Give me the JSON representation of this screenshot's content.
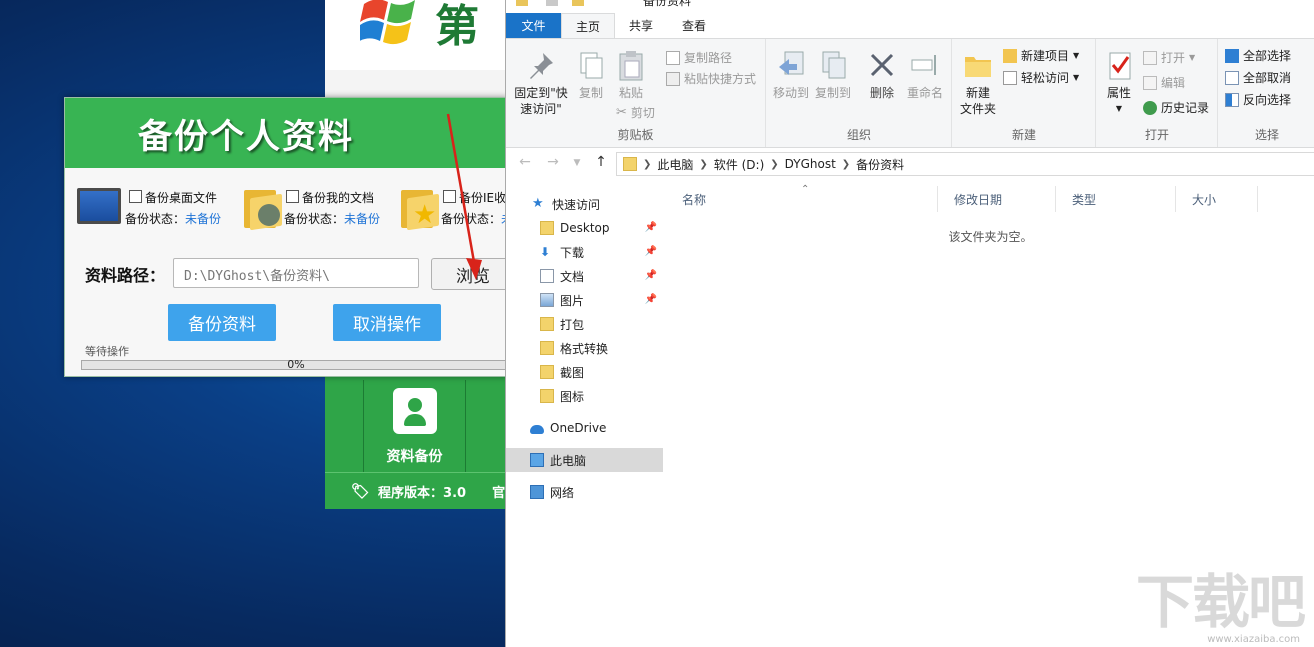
{
  "bg_app": {
    "title_partial": "第一",
    "tile_label": "资料备份",
    "version_text": "程序版本：3.0",
    "footer_tail": "官"
  },
  "dialog": {
    "title": "备份个人资料",
    "options": [
      {
        "label": "备份桌面文件",
        "status_label": "备份状态：",
        "status_value": "未备份"
      },
      {
        "label": "备份我的文档",
        "status_label": "备份状态：",
        "status_value": "未备份"
      },
      {
        "label": "备份IE收",
        "status_label": "备份状态：",
        "status_value": "未"
      }
    ],
    "path_label": "资料路径：",
    "path_value": "D:\\DYGhost\\备份资料\\",
    "browse_label": "浏览",
    "backup_button": "备份资料",
    "cancel_button": "取消操作",
    "wait_text": "等待操作",
    "progress": "0%",
    "progress_value": 0
  },
  "explorer": {
    "window_title": "备份资料",
    "tabs": [
      "文件",
      "主页",
      "共享",
      "查看"
    ],
    "ribbon": {
      "clipboard": {
        "pin_label_1": "固定到\"快",
        "pin_label_2": "速访问\"",
        "copy": "复制",
        "paste": "粘贴",
        "copy_path": "复制路径",
        "paste_shortcut": "粘贴快捷方式",
        "cut": "剪切",
        "title": "剪贴板"
      },
      "organize": {
        "move_to": "移动到",
        "copy_to": "复制到",
        "delete": "删除",
        "rename": "重命名",
        "title": "组织"
      },
      "new": {
        "new_folder_1": "新建",
        "new_folder_2": "文件夹",
        "new_item": "新建项目",
        "easy_access": "轻松访问",
        "title": "新建"
      },
      "open": {
        "properties": "属性",
        "open": "打开",
        "edit": "编辑",
        "history": "历史记录",
        "title": "打开"
      },
      "select": {
        "select_all": "全部选择",
        "select_none": "全部取消",
        "invert": "反向选择",
        "title": "选择"
      }
    },
    "breadcrumb": [
      "此电脑",
      "软件 (D:)",
      "DYGhost",
      "备份资料"
    ],
    "nav": {
      "quick_access": "快速访问",
      "items": [
        "Desktop",
        "下载",
        "文档",
        "图片",
        "打包",
        "格式转换",
        "截图",
        "图标"
      ],
      "onedrive": "OneDrive",
      "this_pc": "此电脑",
      "network": "网络"
    },
    "columns": [
      "名称",
      "修改日期",
      "类型",
      "大小"
    ],
    "empty_message": "该文件夹为空。"
  },
  "watermark": {
    "main": "下载吧",
    "sub": "www.xiazaiba.com"
  }
}
